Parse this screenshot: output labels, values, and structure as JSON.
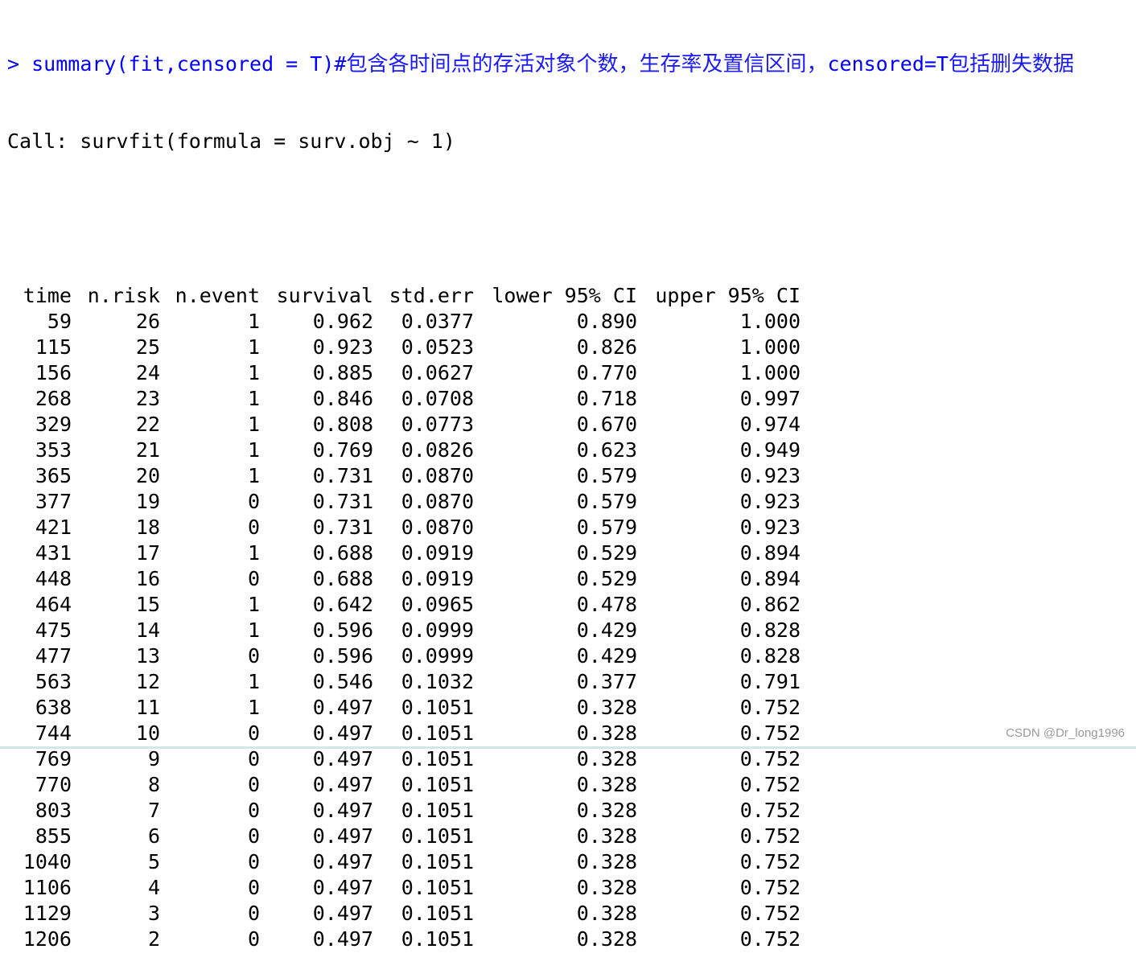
{
  "console": {
    "prompt": "> ",
    "command": "summary(fit,censored = T)#",
    "comment": "包含各时间点的存活对象个数，生存率及置信区间，",
    "command2": "censored=T",
    "comment2": "包括删失数据",
    "call_line": "Call: survfit(formula = surv.obj ~ 1)"
  },
  "table": {
    "headers": [
      "time",
      "n.risk",
      "n.event",
      "survival",
      "std.err",
      "lower 95% CI",
      "upper 95% CI"
    ],
    "rows": [
      [
        "59",
        "26",
        "1",
        "0.962",
        "0.0377",
        "0.890",
        "1.000"
      ],
      [
        "115",
        "25",
        "1",
        "0.923",
        "0.0523",
        "0.826",
        "1.000"
      ],
      [
        "156",
        "24",
        "1",
        "0.885",
        "0.0627",
        "0.770",
        "1.000"
      ],
      [
        "268",
        "23",
        "1",
        "0.846",
        "0.0708",
        "0.718",
        "0.997"
      ],
      [
        "329",
        "22",
        "1",
        "0.808",
        "0.0773",
        "0.670",
        "0.974"
      ],
      [
        "353",
        "21",
        "1",
        "0.769",
        "0.0826",
        "0.623",
        "0.949"
      ],
      [
        "365",
        "20",
        "1",
        "0.731",
        "0.0870",
        "0.579",
        "0.923"
      ],
      [
        "377",
        "19",
        "0",
        "0.731",
        "0.0870",
        "0.579",
        "0.923"
      ],
      [
        "421",
        "18",
        "0",
        "0.731",
        "0.0870",
        "0.579",
        "0.923"
      ],
      [
        "431",
        "17",
        "1",
        "0.688",
        "0.0919",
        "0.529",
        "0.894"
      ],
      [
        "448",
        "16",
        "0",
        "0.688",
        "0.0919",
        "0.529",
        "0.894"
      ],
      [
        "464",
        "15",
        "1",
        "0.642",
        "0.0965",
        "0.478",
        "0.862"
      ],
      [
        "475",
        "14",
        "1",
        "0.596",
        "0.0999",
        "0.429",
        "0.828"
      ],
      [
        "477",
        "13",
        "0",
        "0.596",
        "0.0999",
        "0.429",
        "0.828"
      ],
      [
        "563",
        "12",
        "1",
        "0.546",
        "0.1032",
        "0.377",
        "0.791"
      ],
      [
        "638",
        "11",
        "1",
        "0.497",
        "0.1051",
        "0.328",
        "0.752"
      ],
      [
        "744",
        "10",
        "0",
        "0.497",
        "0.1051",
        "0.328",
        "0.752"
      ],
      [
        "769",
        "9",
        "0",
        "0.497",
        "0.1051",
        "0.328",
        "0.752"
      ],
      [
        "770",
        "8",
        "0",
        "0.497",
        "0.1051",
        "0.328",
        "0.752"
      ],
      [
        "803",
        "7",
        "0",
        "0.497",
        "0.1051",
        "0.328",
        "0.752"
      ],
      [
        "855",
        "6",
        "0",
        "0.497",
        "0.1051",
        "0.328",
        "0.752"
      ],
      [
        "1040",
        "5",
        "0",
        "0.497",
        "0.1051",
        "0.328",
        "0.752"
      ],
      [
        "1106",
        "4",
        "0",
        "0.497",
        "0.1051",
        "0.328",
        "0.752"
      ],
      [
        "1129",
        "3",
        "0",
        "0.497",
        "0.1051",
        "0.328",
        "0.752"
      ],
      [
        "1206",
        "2",
        "0",
        "0.497",
        "0.1051",
        "0.328",
        "0.752"
      ]
    ]
  },
  "watermark": "CSDN @Dr_long1996",
  "colors": {
    "command": "#0000ff",
    "output": "#000000",
    "watermark": "#9a9a9a",
    "bottom_bar": "#cfe9e6"
  }
}
